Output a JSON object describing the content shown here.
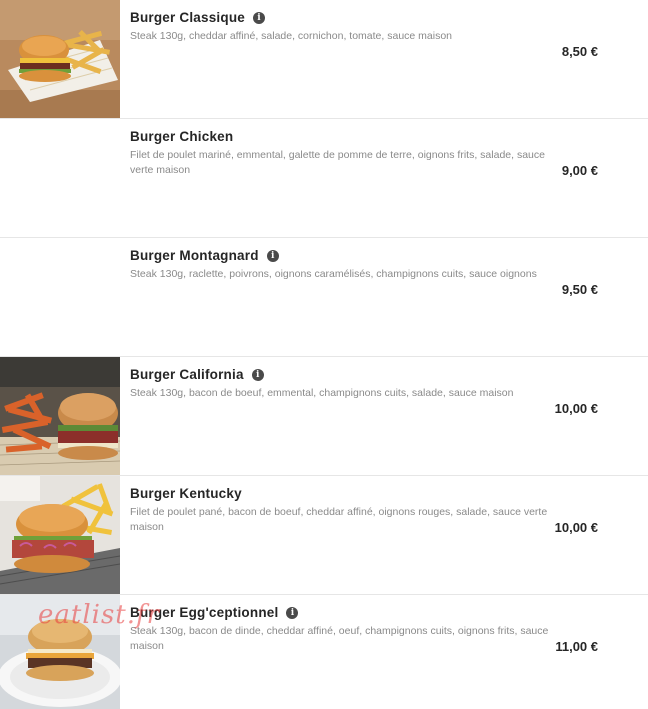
{
  "menu": {
    "items": [
      {
        "name": "Burger Classique",
        "description": "Steak 130g, cheddar affiné, salade, cornichon, tomate, sauce maison",
        "price": "8,50 €",
        "has_info": true,
        "image": "burger-fries-photo"
      },
      {
        "name": "Burger Chicken",
        "description": "Filet de poulet mariné, emmental, galette de pomme de terre, oignons frits, salade, sauce verte maison",
        "price": "9,00 €",
        "has_info": false,
        "image": null
      },
      {
        "name": "Burger Montagnard",
        "description": "Steak 130g, raclette, poivrons, oignons caramélisés, champignons cuits, sauce oignons",
        "price": "9,50 €",
        "has_info": true,
        "image": null
      },
      {
        "name": "Burger California",
        "description": "Steak 130g, bacon de boeuf, emmental, champignons cuits, salade, sauce maison",
        "price": "10,00 €",
        "has_info": true,
        "image": "burger-sweet-potato-fries-photo"
      },
      {
        "name": "Burger Kentucky",
        "description": "Filet de poulet pané, bacon de boeuf, cheddar affiné, oignons rouges, salade, sauce verte maison",
        "price": "10,00 €",
        "has_info": false,
        "image": "burger-fries-basket-photo"
      },
      {
        "name": "Burger Egg'ceptionnel",
        "description": "Steak 130g, bacon de dinde, cheddar affiné, oeuf, champignons cuits, oignons frits, sauce maison",
        "price": "11,00 €",
        "has_info": true,
        "image": "burger-plate-photo"
      }
    ],
    "info_glyph": "i"
  },
  "watermark": "eatlist.fr",
  "colors": {
    "title": "#262626",
    "description": "#8a8a8a",
    "divider": "#e6e6e6",
    "watermark": "#e73c3c"
  }
}
